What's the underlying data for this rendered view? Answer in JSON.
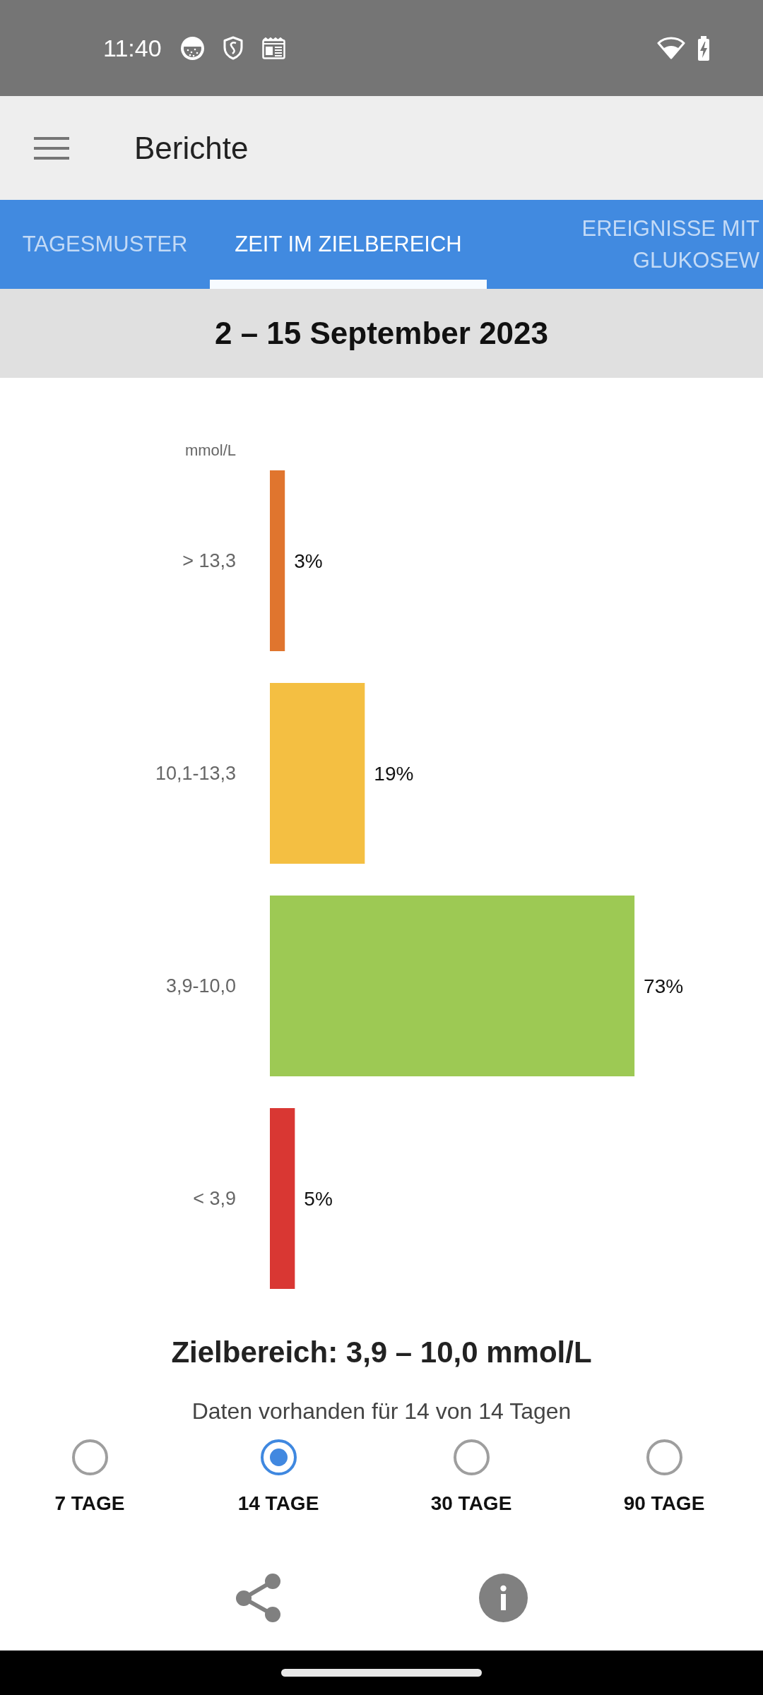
{
  "status_bar": {
    "time": "11:40"
  },
  "app_bar": {
    "title": "Berichte"
  },
  "tabs": [
    {
      "label": "TAGESMUSTER",
      "selected": false
    },
    {
      "label": "ZEIT IM ZIELBEREICH",
      "selected": true
    },
    {
      "label": "EREIGNISSE MIT GLUKOSEW",
      "selected": false
    }
  ],
  "date_range": "2 – 15 September 2023",
  "chart": {
    "chart_data": {
      "type": "bar",
      "orientation": "horizontal",
      "ylabel": "mmol/L",
      "categories": [
        "> 13,3",
        "10,1-13,3",
        "3,9-10,0",
        "< 3,9"
      ],
      "values": [
        3,
        19,
        73,
        5
      ],
      "colors": [
        "#e0752e",
        "#f4bf42",
        "#9dc954",
        "#d93733"
      ],
      "value_labels": [
        "3%",
        "19%",
        "73%",
        "5%"
      ]
    }
  },
  "target_range": "Zielbereich: 3,9 – 10,0 mmol/L",
  "data_note": "Daten vorhanden für 14 von 14 Tagen",
  "periods": [
    {
      "label": "7 TAGE",
      "selected": false
    },
    {
      "label": "14 TAGE",
      "selected": true
    },
    {
      "label": "30 TAGE",
      "selected": false
    },
    {
      "label": "90 TAGE",
      "selected": false
    }
  ]
}
